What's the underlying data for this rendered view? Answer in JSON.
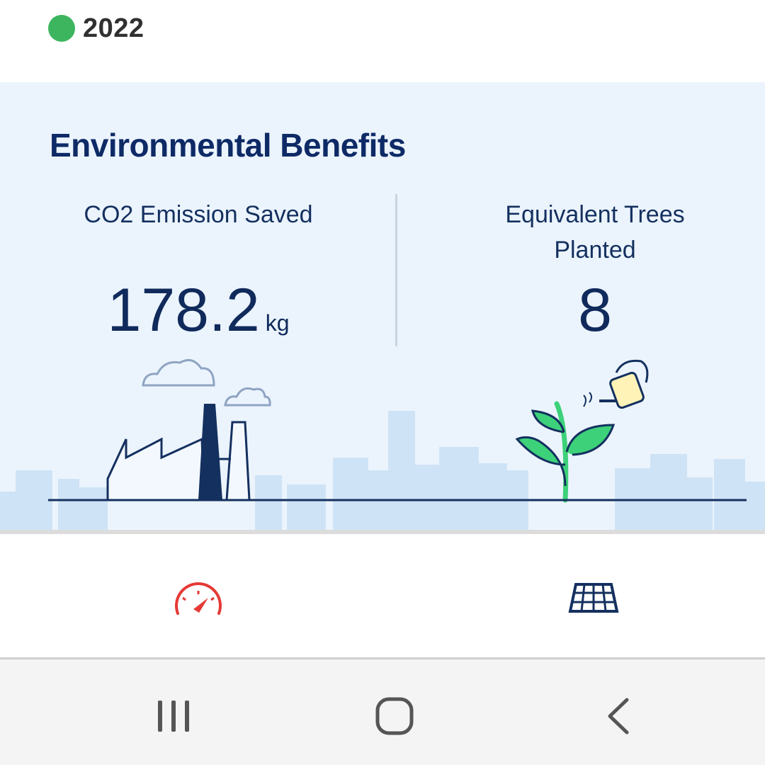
{
  "header": {
    "year": "2022",
    "status_color": "#3cb55e"
  },
  "environment": {
    "title": "Environmental Benefits",
    "co2": {
      "label": "CO2 Emission Saved",
      "value": "178.2",
      "unit": "kg"
    },
    "trees": {
      "label": "Equivalent Trees Planted",
      "value": "8"
    }
  },
  "bottom_tabs": [
    {
      "icon": "gauge-icon",
      "color": "#e53935"
    },
    {
      "icon": "solar-panel-icon",
      "color": "#14305f"
    }
  ],
  "system_nav": {
    "icons": [
      "recents-icon",
      "home-icon",
      "back-icon"
    ]
  },
  "colors": {
    "accent_dark": "#0e2a66",
    "panel_bg": "#ebf4fd",
    "plant_green": "#3dd17a"
  }
}
